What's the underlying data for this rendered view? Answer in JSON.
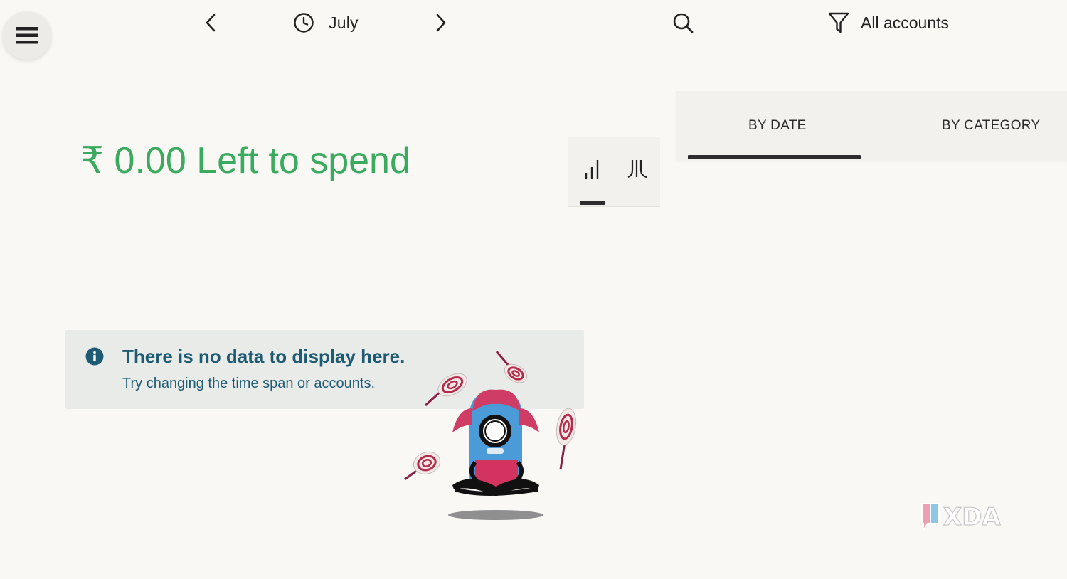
{
  "header": {
    "menu_icon": "hamburger-menu-icon",
    "prev_icon": "chevron-left-icon",
    "period_icon": "clock-icon",
    "month": "July",
    "next_icon": "chevron-right-icon",
    "search_icon": "search-icon",
    "filter_icon": "filter-funnel-icon",
    "accounts_label": "All accounts"
  },
  "summary": {
    "currency": "₹",
    "amount": "0.00",
    "caption": "Left to spend",
    "color": "#3aab5e"
  },
  "chart_mode": {
    "options": [
      {
        "icon": "bar-chart-icon",
        "selected": true
      },
      {
        "icon": "bar-chart-split-icon",
        "selected": false
      }
    ]
  },
  "tabs": [
    {
      "label": "BY DATE",
      "selected": true
    },
    {
      "label": "BY CATEGORY",
      "selected": false
    }
  ],
  "empty_state": {
    "icon": "info-icon",
    "title": "There is no data to display here.",
    "subtitle": "Try changing the time span or accounts.",
    "illustration": "juggling-monster-lollipops-illustration",
    "text_color": "#1d5a73"
  },
  "watermark": {
    "brand": "XDA"
  }
}
